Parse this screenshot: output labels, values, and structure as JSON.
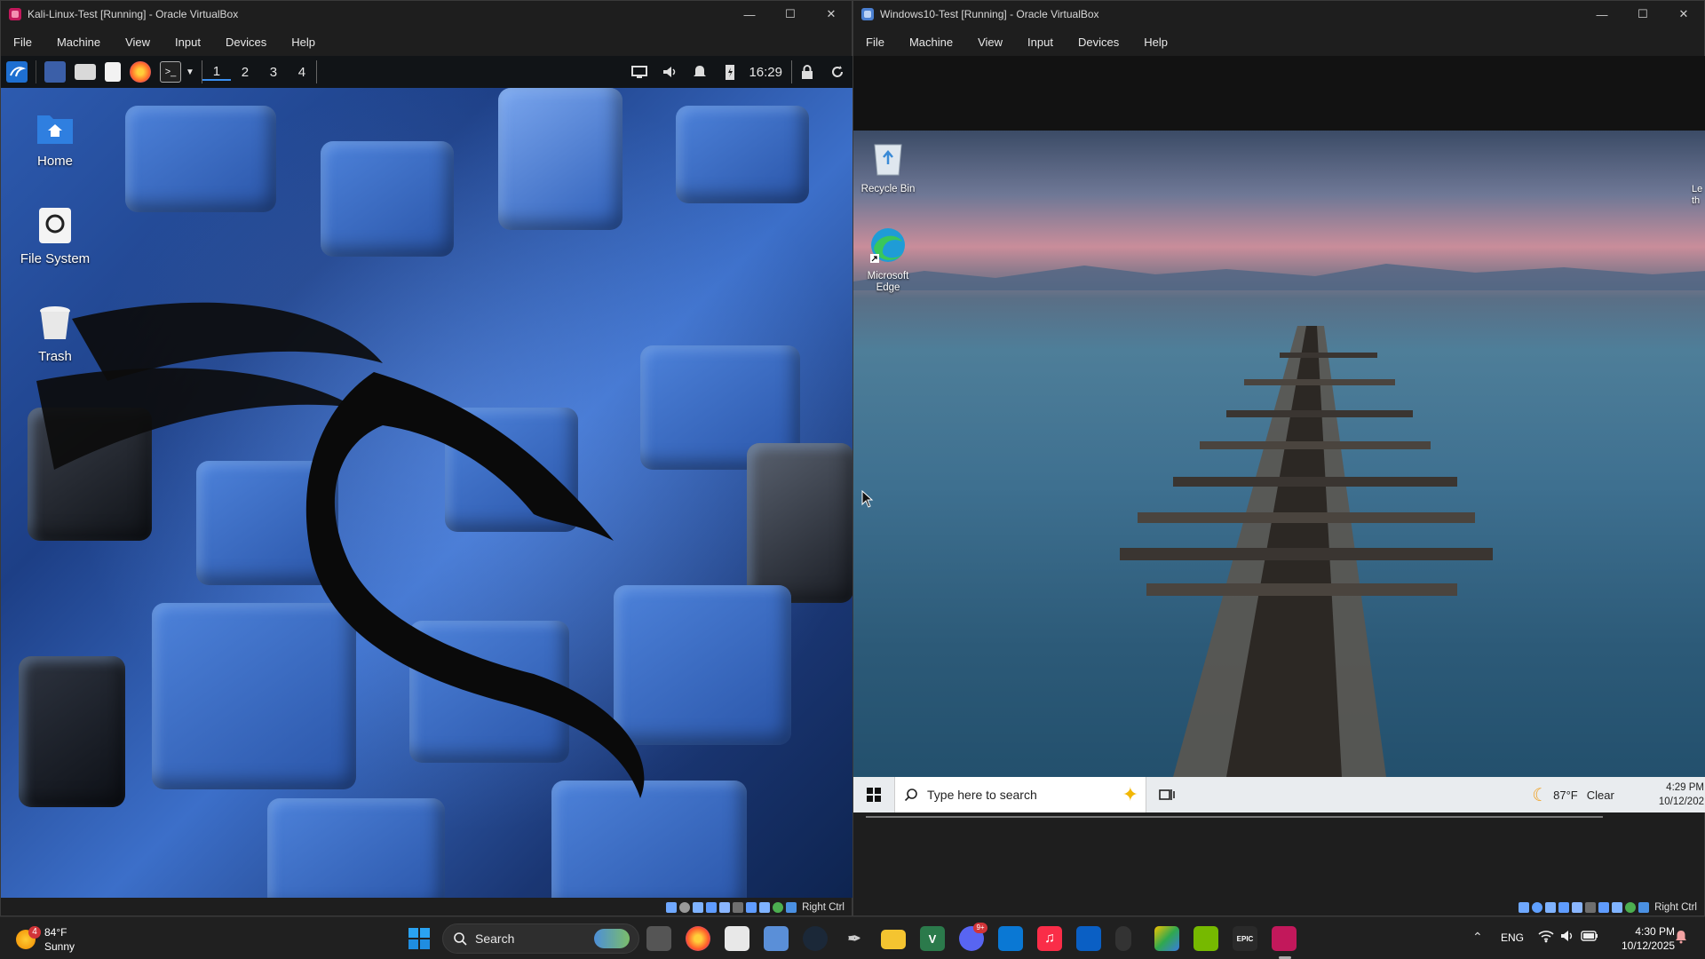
{
  "kali_window": {
    "title": "Kali-Linux-Test [Running] - Oracle VirtualBox",
    "menu": [
      "File",
      "Machine",
      "View",
      "Input",
      "Devices",
      "Help"
    ],
    "panel": {
      "workspaces": [
        "1",
        "2",
        "3",
        "4"
      ],
      "clock": "16:29"
    },
    "desktop_icons": [
      {
        "label": "Home",
        "icon": "home-folder-icon"
      },
      {
        "label": "File System",
        "icon": "drive-icon"
      },
      {
        "label": "Trash",
        "icon": "trash-icon"
      }
    ],
    "status_host_key": "Right Ctrl"
  },
  "win10_window": {
    "title": "Windows10-Test [Running] - Oracle VirtualBox",
    "menu": [
      "File",
      "Machine",
      "View",
      "Input",
      "Devices",
      "Help"
    ],
    "desktop_icons": [
      {
        "label": "Recycle Bin",
        "icon": "recycle-bin-icon"
      },
      {
        "label": "Microsoft Edge",
        "icon": "edge-icon"
      }
    ],
    "edge_text": "Le th",
    "taskbar": {
      "search_placeholder": "Type here to search",
      "weather": "87°F",
      "weather_cond": "Clear",
      "time": "4:29 PM",
      "date": "10/12/202"
    },
    "status_host_key": "Right Ctrl"
  },
  "host_taskbar": {
    "weather_temp": "84°F",
    "weather_cond": "Sunny",
    "weather_badge": "4",
    "search_label": "Search",
    "lang": "ENG",
    "time": "4:30 PM",
    "date": "10/12/2025",
    "discord_badge": "9+",
    "colors": {
      "accent": "#0078d4",
      "bg": "#202020"
    }
  }
}
